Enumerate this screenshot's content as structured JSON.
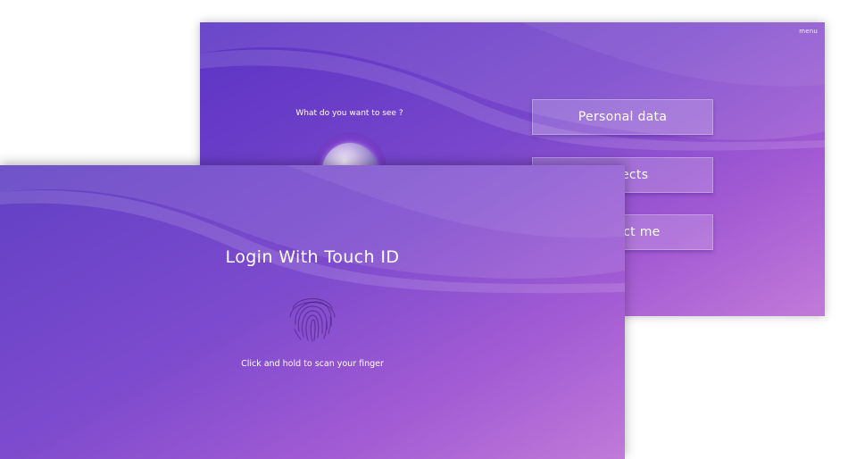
{
  "menu_screen": {
    "menu_label": "menu",
    "question": "What do you want to see ?",
    "buttons": [
      {
        "label": "Personal data"
      },
      {
        "label": "Projects"
      },
      {
        "label": "Contact me"
      }
    ]
  },
  "login_screen": {
    "title": "Login With Touch ID",
    "hint": "Click and hold to scan your finger"
  },
  "colors": {
    "gradient_start": "#5a33c4",
    "gradient_end": "#c27ad9",
    "text": "#ffffff"
  },
  "icons": [
    "fingerprint-icon",
    "orb-icon"
  ]
}
